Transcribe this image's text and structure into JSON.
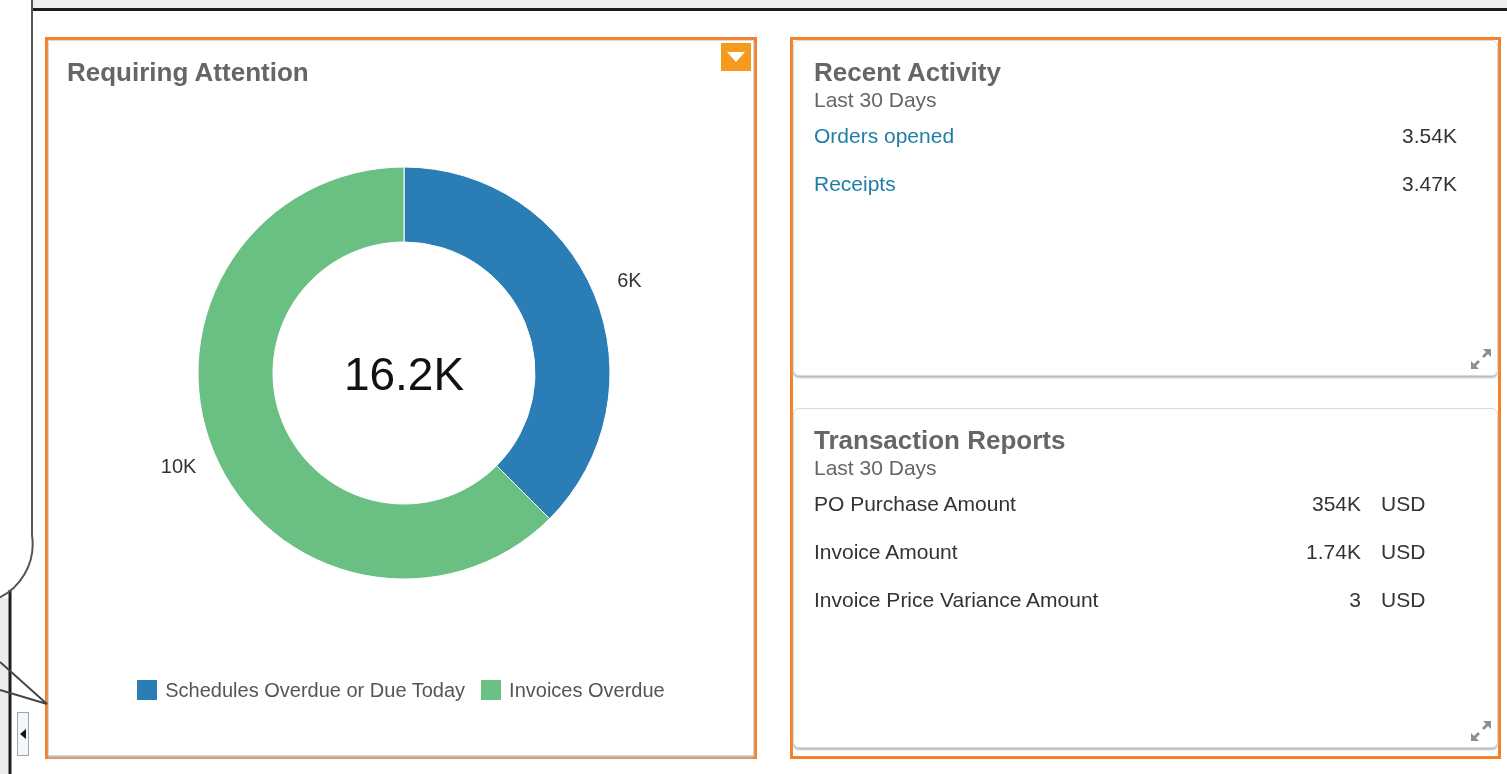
{
  "requiring_attention": {
    "highlighted": true,
    "title": "Requiring Attention",
    "center_total": "16.2K",
    "chart_data": {
      "type": "donut",
      "categories": [
        "Schedules Overdue or Due Today",
        "Invoices Overdue"
      ],
      "colors": [
        "#2a7db5",
        "#69c082"
      ],
      "series": [
        {
          "values": [
            37.5,
            62.5
          ]
        }
      ],
      "value_labels": [
        "6K",
        "10K"
      ]
    }
  },
  "right_column": {
    "highlighted": true,
    "cards": [
      {
        "kind": "links",
        "title": "Recent Activity",
        "subtitle": "Last 30 Days",
        "rows": [
          {
            "label": "Orders opened",
            "value": "3.54K"
          },
          {
            "label": "Receipts",
            "value": "3.47K"
          }
        ]
      },
      {
        "kind": "amounts",
        "title": "Transaction Reports",
        "subtitle": "Last 30 Days",
        "rows": [
          {
            "label": "PO Purchase Amount",
            "value": "354K",
            "unit": "USD"
          },
          {
            "label": "Invoice Amount",
            "value": "1.74K",
            "unit": "USD"
          },
          {
            "label": "Invoice Price Variance Amount",
            "value": "3",
            "unit": "USD"
          }
        ]
      }
    ]
  }
}
